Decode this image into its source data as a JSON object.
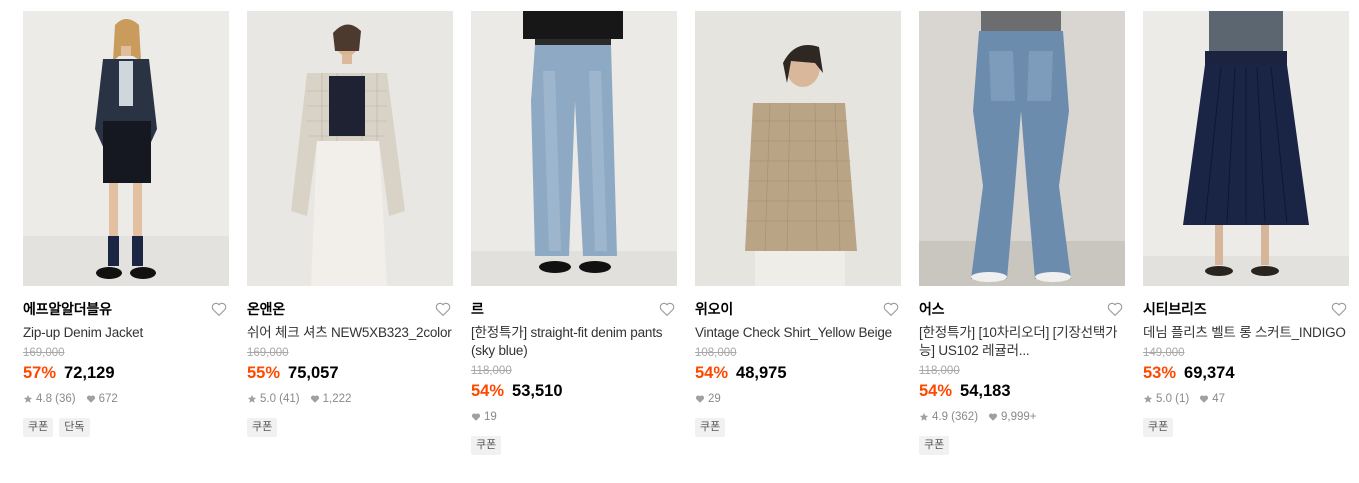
{
  "products": [
    {
      "brand": "에프알알더블유",
      "name": "Zip-up Denim Jacket",
      "original_price": "169,000",
      "discount": "57%",
      "price": "72,129",
      "rating": "4.8 (36)",
      "likes": "672",
      "tags": [
        "쿠폰",
        "단독"
      ],
      "image_icon": "model-denim-jacket-photo"
    },
    {
      "brand": "온앤온",
      "name": "쉬어 체크 셔츠 NEW5XB323_2color",
      "original_price": "169,000",
      "discount": "55%",
      "price": "75,057",
      "rating": "5.0 (41)",
      "likes": "1,222",
      "tags": [
        "쿠폰"
      ],
      "image_icon": "model-check-shirt-photo"
    },
    {
      "brand": "르",
      "name": "[한정특가] straight-fit denim pants (sky blue)",
      "original_price": "118,000",
      "discount": "54%",
      "price": "53,510",
      "rating": "",
      "likes": "19",
      "tags": [
        "쿠폰"
      ],
      "image_icon": "model-denim-pants-photo"
    },
    {
      "brand": "위오이",
      "name": "Vintage Check Shirt_Yellow Beige",
      "original_price": "108,000",
      "discount": "54%",
      "price": "48,975",
      "rating": "",
      "likes": "29",
      "tags": [
        "쿠폰"
      ],
      "image_icon": "model-vintage-shirt-photo"
    },
    {
      "brand": "어스",
      "name": "[한정특가] [10차리오더] [기장선택가능] US102 레귤러...",
      "original_price": "118,000",
      "discount": "54%",
      "price": "54,183",
      "rating": "4.9 (362)",
      "likes": "9,999+",
      "tags": [
        "쿠폰"
      ],
      "image_icon": "model-flare-jeans-photo"
    },
    {
      "brand": "시티브리즈",
      "name": "데님 플리츠 벨트 롱 스커트_INDIGO",
      "original_price": "149,000",
      "discount": "53%",
      "price": "69,374",
      "rating": "5.0 (1)",
      "likes": "47",
      "tags": [
        "쿠폰"
      ],
      "image_icon": "model-pleated-skirt-photo"
    }
  ],
  "colors": {
    "discount": "#ff4800",
    "muted": "#8a8a8a",
    "tag_bg": "#f1f1f1"
  }
}
